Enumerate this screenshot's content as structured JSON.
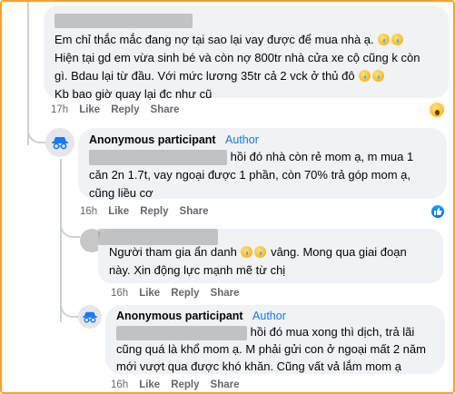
{
  "comments": [
    {
      "author_hidden": true,
      "text_lines": [
        "Em chỉ thắc mắc đang nợ tại sao lại vay được để mua nhà ạ.",
        "Hiện tại gd em vừa sinh bé và còn nợ 800tr nhà cửa xe cộ cũng k còn",
        "gì. Bdau lại từ đầu. Với mức lương 35tr cả 2 vck ở thủ đô",
        "Kb bao giờ quay lại đc như cũ"
      ],
      "time": "17h",
      "like_label": "Like",
      "reply_label": "Reply",
      "share_label": "Share",
      "reaction": "wow"
    },
    {
      "author": "Anonymous participant",
      "badge": "Author",
      "text_lines": [
        "hồi đó nhà còn rẻ mom ạ, m mua 1",
        "căn 2n 1.7t, vay ngoại được 1 phần, còn 70% trả góp mom ạ,",
        "cũng liều cơ"
      ],
      "time": "16h",
      "like_label": "Like",
      "reply_label": "Reply",
      "share_label": "Share",
      "reaction": "like"
    },
    {
      "author_hidden": true,
      "text_lines": [
        "Người tham gia ẩn danh",
        "vâng. Mong qua giai đoạn",
        "này. Xin động lực mạnh mẽ từ chị"
      ],
      "time": "16h",
      "like_label": "Like",
      "reply_label": "Reply",
      "share_label": "Share"
    },
    {
      "author": "Anonymous participant",
      "badge": "Author",
      "text_lines": [
        "hồi đó mua xong thì dịch, trả lãi",
        "cũng quá là khổ mom ạ. M phải gửi con ở ngoại mất 2 năm",
        "mới vượt qua được khó khăn. Cũng vất vả lắm mom ạ"
      ],
      "time": "16h",
      "like_label": "Like",
      "reply_label": "Reply",
      "share_label": "Share"
    }
  ],
  "colors": {
    "frame": "#f0a52a",
    "bubble": "#f0f2f5",
    "author_badge": "#1877f2",
    "meta_text": "#65676b"
  },
  "icons": [
    "anonymous-avatar-icon",
    "wow-reaction-icon",
    "like-reaction-icon",
    "crying-emoji-icon"
  ]
}
